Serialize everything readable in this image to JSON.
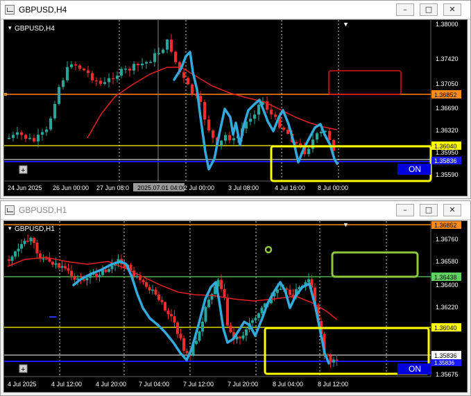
{
  "windows": [
    {
      "title": "GBPUSD,H4",
      "chart_label": "GBPUSD,H4",
      "price_labels": [
        "1.38000",
        "1.37420",
        "1.37050",
        "1.36690",
        "1.36320",
        "1.35950",
        "1.35590"
      ],
      "level_labels": {
        "orange": "1.36852",
        "yellow": "1.36040",
        "blue": "1.35836"
      },
      "time_labels": [
        "24 Jun 2025",
        "26 Jun 00:00",
        "27 Jun 08:0",
        "2025.07.01 04:00",
        "2 Jul 00:00",
        "3 Jul 08:00",
        "4 Jul 16:00",
        "8 Jul 00:00"
      ],
      "on_label": "ON",
      "plus_label": "+"
    },
    {
      "title": "GBPUSD,H1",
      "chart_label": "GBPUSD,H1",
      "price_labels": [
        "1.36760",
        "1.36580",
        "1.36400",
        "1.36220",
        "1.35675"
      ],
      "level_labels": {
        "orange": "1.36852",
        "green": "1.36438",
        "yellow": "1.36040",
        "white": "1.35836",
        "blue": "1.35836"
      },
      "time_labels": [
        "4 Jul 2025",
        "4 Jul 12:00",
        "4 Jul 20:00",
        "7 Jul 04:00",
        "7 Jul 12:00",
        "7 Jul 20:00",
        "8 Jul 04:00",
        "8 Jul 12:00"
      ],
      "on_label": "ON",
      "plus_label": "+"
    }
  ],
  "colors": {
    "bull": "#26a69a",
    "bear": "#ef2b2b",
    "ma": "#e82020",
    "hand": "#33aadd",
    "orange": "#ff8c1a",
    "yellow": "#ffff00",
    "green": "#5fd35f",
    "blue": "#1a1aff",
    "box_red": "#dd1111",
    "box_green": "#8dc63f"
  },
  "icons": {
    "minimize": "minimize-icon",
    "maximize": "maximize-icon",
    "close": "close-icon"
  }
}
